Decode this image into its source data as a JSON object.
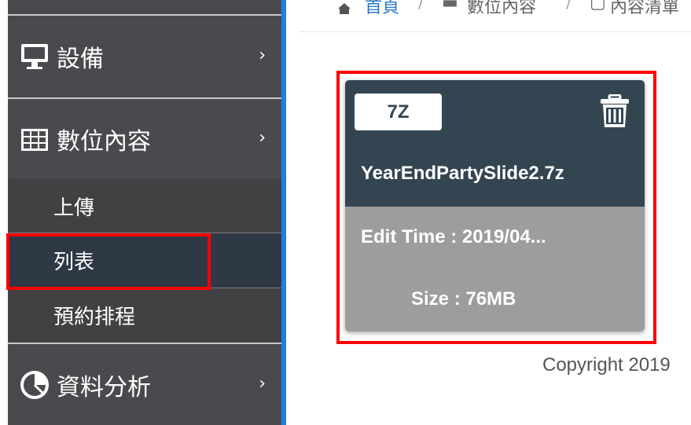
{
  "sidebar": {
    "items": [
      {
        "label": "設備",
        "icon": "monitor-icon"
      },
      {
        "label": "數位內容",
        "icon": "grid-icon"
      },
      {
        "label": "資料分析",
        "icon": "pie-chart-icon"
      }
    ],
    "subitems": [
      {
        "label": "上傳"
      },
      {
        "label": "列表"
      },
      {
        "label": "預約排程"
      }
    ],
    "chevron": "›"
  },
  "breadcrumb": {
    "home": "首頁",
    "digital_content": "數位內容",
    "content_list": "內容清單"
  },
  "card": {
    "type_badge": "7Z",
    "filename": "YearEndPartySlide2.7z",
    "edit_time": "Edit Time : 2019/04...",
    "size": "Size : 76MB"
  },
  "footer": {
    "copyright": "Copyright 2019"
  },
  "colors": {
    "sidebar_bg": "#4a4a4e",
    "active_item_bg": "#2f3845",
    "accent_blue": "#1e7ee6",
    "card_header": "#344552",
    "card_body": "#9d9d9d",
    "highlight": "#ff0000"
  }
}
